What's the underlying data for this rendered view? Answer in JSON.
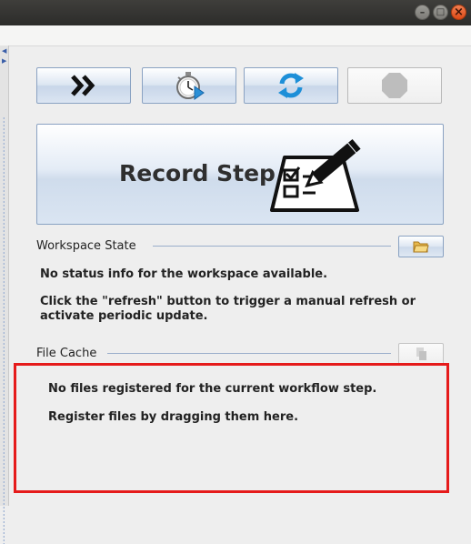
{
  "window": {
    "controls": {
      "minimize_glyph": "–",
      "maximize_glyph": "□",
      "close_glyph": "×"
    },
    "accent_color": "#e05420"
  },
  "toolbar": {
    "buttons": [
      {
        "icon": "fast-forward-icon",
        "enabled": true
      },
      {
        "icon": "stopwatch-icon",
        "enabled": true
      },
      {
        "icon": "refresh-icon",
        "enabled": true
      },
      {
        "icon": "stop-octagon-icon",
        "enabled": false
      }
    ]
  },
  "record": {
    "label": "Record Step",
    "icon": "checklist-pencil-icon"
  },
  "workspace": {
    "title": "Workspace State",
    "status_line": "No status info for the workspace available.",
    "hint_line1": "Click the \"refresh\" button to trigger a manual refresh or",
    "hint_line2": "activate periodic update.",
    "open_icon": "folder-icon"
  },
  "file_cache": {
    "title": "File Cache",
    "empty_line": "No files registered for the current workflow step.",
    "hint_line": "Register files by dragging them here.",
    "highlight_color": "#e51a1a"
  }
}
